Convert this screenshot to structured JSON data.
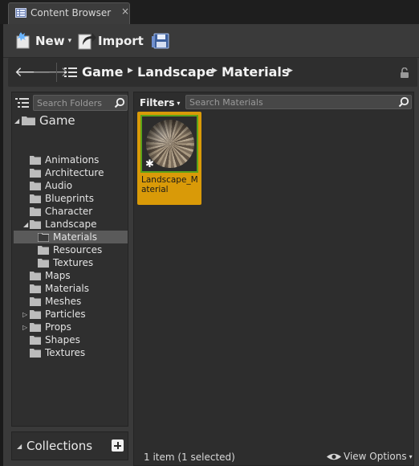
{
  "tab": {
    "title": "Content Browser",
    "close_glyph": "×",
    "icon": "content-browser-icon"
  },
  "toolbar": {
    "new_label": "New",
    "import_label": "Import",
    "caret": "▾",
    "save_icon": "save-icon"
  },
  "pathbar": {
    "back_glyph": "🡐",
    "forward_glyph": "🡒",
    "crumbs": [
      "Game",
      "Landscape",
      "Materials"
    ],
    "sep_glyph": "▶",
    "lock_icon": "lock-icon"
  },
  "tree": {
    "search_placeholder": "Search Folders",
    "root": "Game",
    "items": [
      "Animations",
      "Architecture",
      "Audio",
      "Blueprints",
      "Character",
      "Landscape",
      "Materials",
      "Resources",
      "Textures",
      "Maps",
      "Materials",
      "Meshes",
      "Particles",
      "Props",
      "Shapes",
      "Textures"
    ],
    "expanded_glyph": "◢",
    "collapsed_glyph": "▷"
  },
  "collections": {
    "label": "Collections",
    "caret": "◢"
  },
  "assets": {
    "filters_label": "Filters",
    "search_placeholder": "Search Materials",
    "items": [
      {
        "name": "Landscape_Material",
        "star": "✱"
      }
    ]
  },
  "status": {
    "count_text": "1 item (1 selected)",
    "view_options_label": "View Options",
    "caret": "▾"
  },
  "colors": {
    "selection": "#d99a08",
    "material_border": "#5aa21a",
    "panel": "#3a3a3a"
  }
}
